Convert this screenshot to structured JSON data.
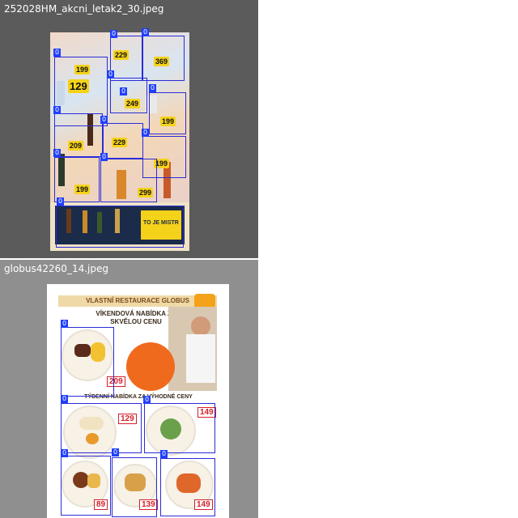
{
  "panels": [
    {
      "filename": "252028HM_akcni_letak2_30.jpeg",
      "detection_label": "0",
      "leaflet": {
        "prices": [
          "129",
          "199",
          "229",
          "369",
          "199",
          "249",
          "199",
          "229",
          "209",
          "199",
          "299"
        ],
        "footer_text": "TO JE MISTR"
      }
    },
    {
      "filename": "globus42260_14.jpeg",
      "detection_label": "0",
      "leaflet": {
        "header": "VLASTNÍ RESTAURACE GLOBUS",
        "promo_title": "VÍKENDOVÁ NABÍDKA ZA SKVĚLOU CENU",
        "week_title": "TÝDENNÍ NABÍDKA ZA VÝHODNÉ CENY",
        "prices": [
          "209",
          "149",
          "129",
          "89",
          "139",
          "149"
        ]
      }
    }
  ],
  "colors": {
    "box": "#2b2bd8",
    "tag": "#1f3fff",
    "price_yellow": "#f5d21a",
    "globus_orange": "#f06a1e"
  }
}
